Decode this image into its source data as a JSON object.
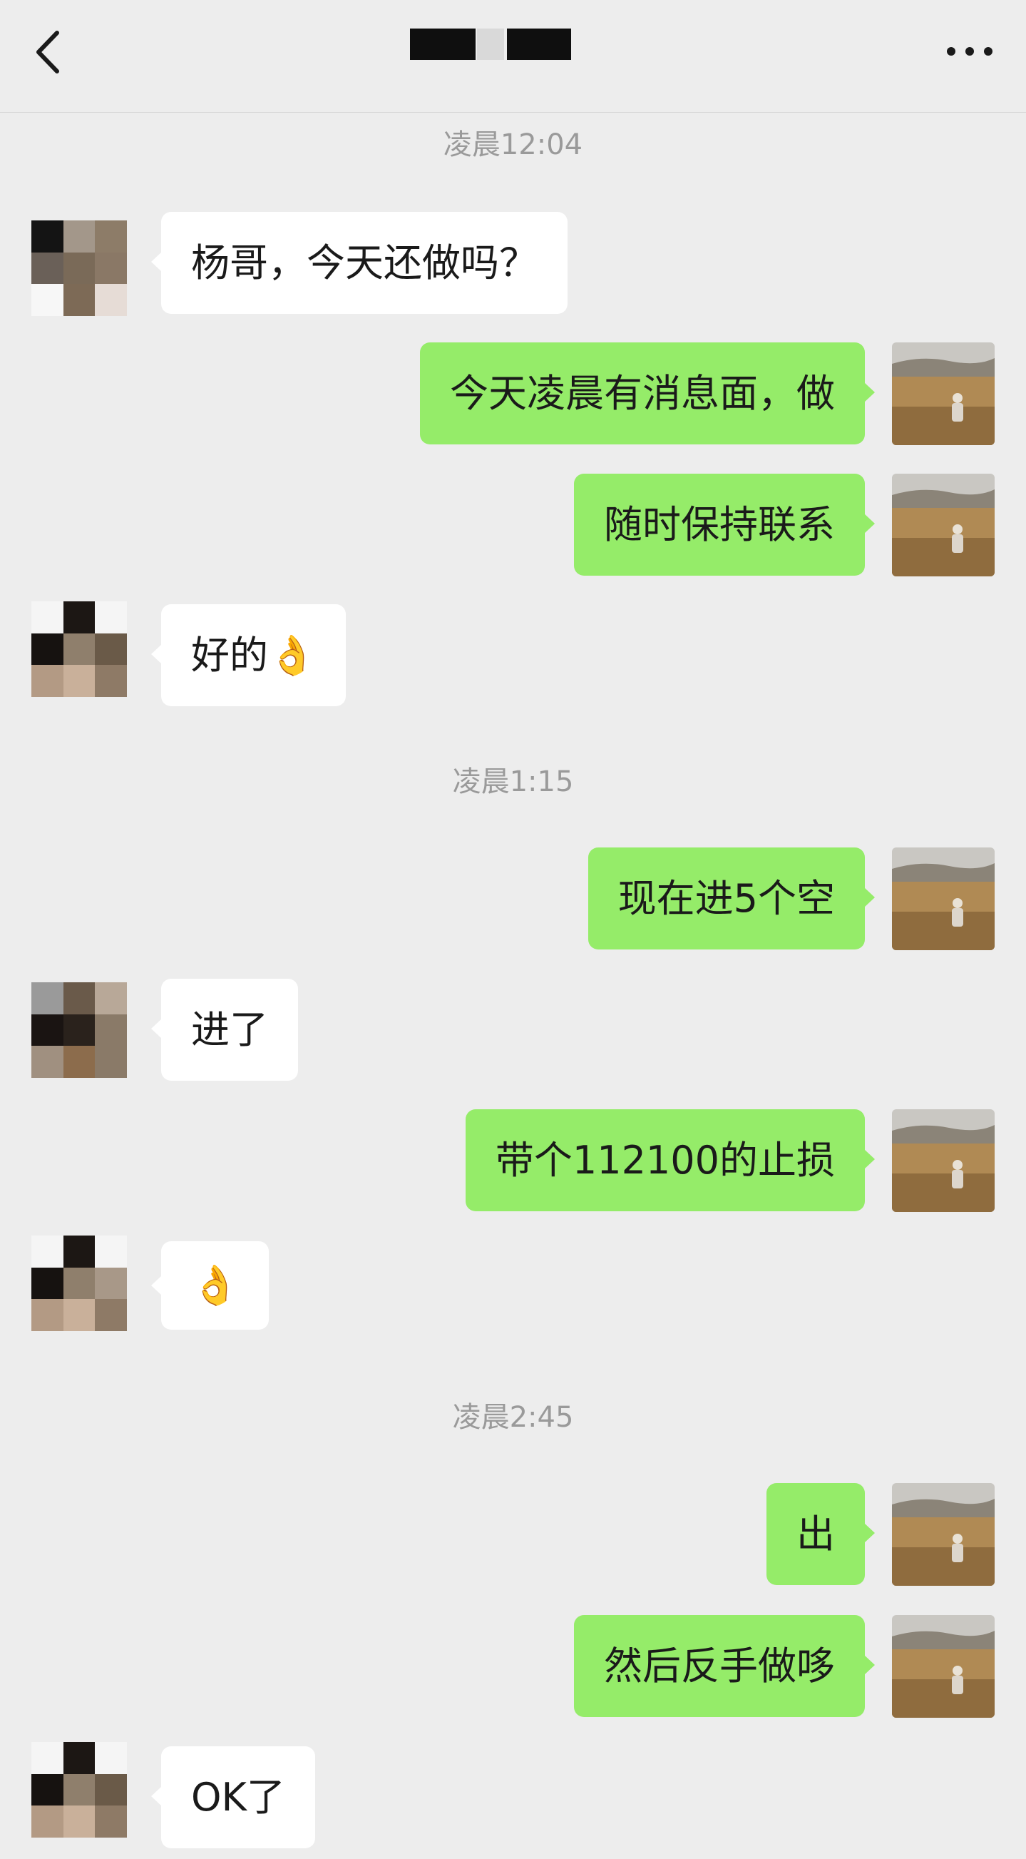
{
  "header": {
    "back_icon": "chevron-left-icon",
    "more_icon": "more-dots-icon"
  },
  "timestamps": [
    "凌晨12:04",
    "凌晨1:15",
    "凌晨2:45"
  ],
  "messages": [
    {
      "side": "in",
      "text": "杨哥，今天还做吗？"
    },
    {
      "side": "out",
      "text": "今天凌晨有消息面，做"
    },
    {
      "side": "out",
      "text": "随时保持联系"
    },
    {
      "side": "in",
      "text": "好的👌"
    },
    {
      "side": "out",
      "text": "现在进5个空"
    },
    {
      "side": "in",
      "text": "进了"
    },
    {
      "side": "out",
      "text": "带个112100的止损"
    },
    {
      "side": "in",
      "text": "👌"
    },
    {
      "side": "out",
      "text": "出"
    },
    {
      "side": "out",
      "text": "然后反手做哆"
    },
    {
      "side": "in",
      "text": "OK了"
    }
  ],
  "colors": {
    "incoming_bubble": "#ffffff",
    "outgoing_bubble": "#95ec69",
    "background": "#ededed"
  }
}
